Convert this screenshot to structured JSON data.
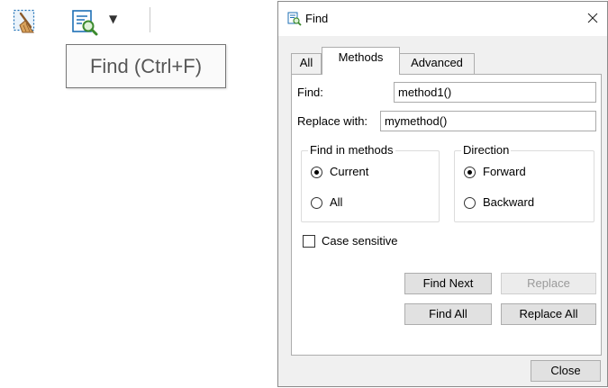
{
  "toolbar": {
    "clear_icon": "broom-clear-icon",
    "find_icon": "find-magnifier-icon",
    "dropdown_icon": "chevron-down-icon",
    "dropdown_glyph": "▼",
    "tooltip": "Find (Ctrl+F)"
  },
  "dialog": {
    "title": "Find",
    "tabs": [
      {
        "label": "All",
        "selected": false
      },
      {
        "label": "Methods",
        "selected": true
      },
      {
        "label": "Advanced",
        "selected": false
      }
    ],
    "find_label": "Find:",
    "find_value": "method1()",
    "replace_label": "Replace with:",
    "replace_value": "mymethod()",
    "find_in_methods": {
      "legend": "Find in methods",
      "options": [
        {
          "label": "Current",
          "selected": true
        },
        {
          "label": "All",
          "selected": false
        }
      ]
    },
    "direction": {
      "legend": "Direction",
      "options": [
        {
          "label": "Forward",
          "selected": true
        },
        {
          "label": "Backward",
          "selected": false
        }
      ]
    },
    "case_sensitive": {
      "label": "Case sensitive",
      "checked": false
    },
    "buttons": {
      "find_next": "Find Next",
      "replace": "Replace",
      "find_all": "Find All",
      "replace_all": "Replace All",
      "close": "Close"
    }
  }
}
